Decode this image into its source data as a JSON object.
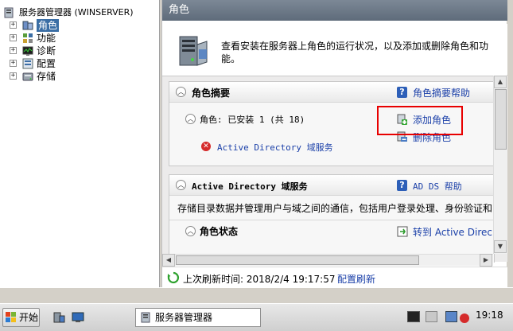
{
  "tree": {
    "root": "服务器管理器 (WINSERVER)",
    "items": [
      {
        "label": "角色",
        "selected": true,
        "expander": "+"
      },
      {
        "label": "功能",
        "expander": "+"
      },
      {
        "label": "诊断",
        "expander": "+"
      },
      {
        "label": "配置",
        "expander": "+"
      },
      {
        "label": "存储",
        "expander": "+"
      }
    ]
  },
  "panel": {
    "title": "角色",
    "intro": "查看安装在服务器上角色的运行状况，以及添加或删除角色和功能。"
  },
  "roles_summary": {
    "title": "角色摘要",
    "help": "角色摘要帮助",
    "status": "角色: 已安装 1 (共 18)",
    "roles": [
      "Active Directory 域服务"
    ],
    "add": "添加角色",
    "remove": "删除角色"
  },
  "ad_section": {
    "title": "Active Directory 域服务",
    "help": "AD DS 帮助",
    "description": "存储目录数据并管理用户与域之间的通信，包括用户登录处理、身份验证和",
    "role_status": "角色状态",
    "goto": "转到 Active Direc"
  },
  "refresh": {
    "last": "上次刷新时间: 2018/2/4 19:17:57",
    "configure": "配置刷新"
  },
  "taskbar": {
    "start": "开始",
    "app": "服务器管理器",
    "clock": "19:18"
  },
  "colors": {
    "highlight": "#e80000",
    "link": "#1a3fa8",
    "title_bar": "#6b7786"
  }
}
